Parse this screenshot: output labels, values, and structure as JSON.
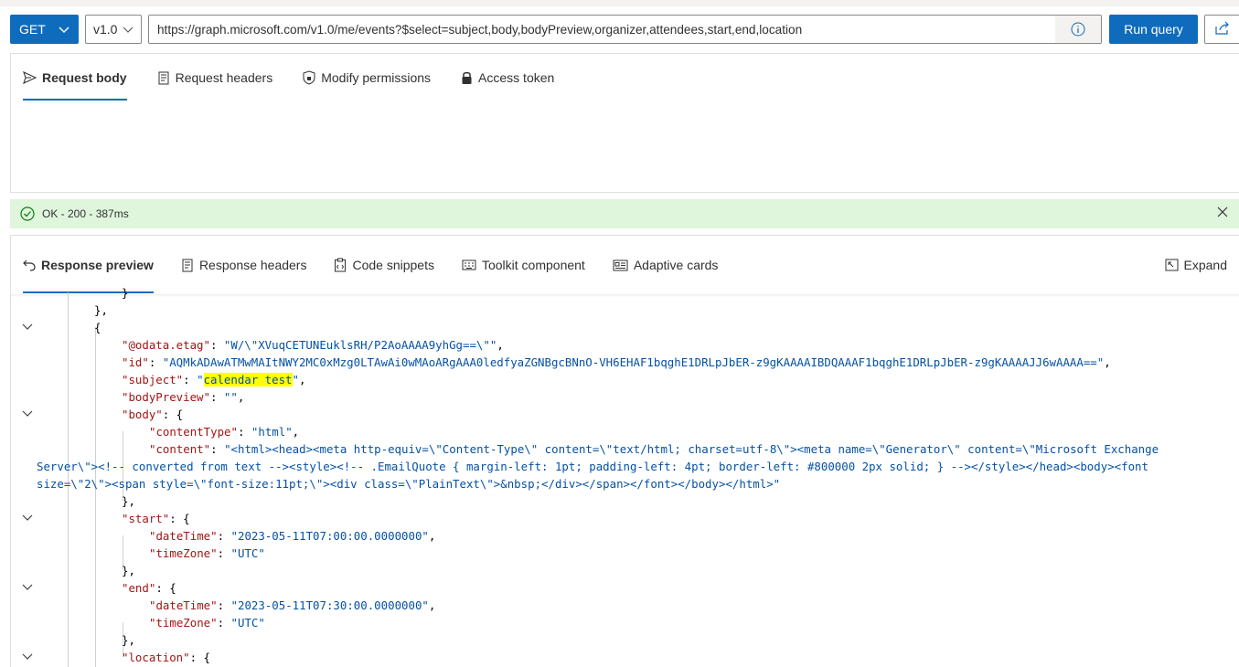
{
  "query": {
    "method": "GET",
    "version": "v1.0",
    "url": "https://graph.microsoft.com/v1.0/me/events?$select=subject,body,bodyPreview,organizer,attendees,start,end,location",
    "run_label": "Run query"
  },
  "request_tabs": [
    {
      "label": "Request body",
      "icon": "send-icon",
      "active": true
    },
    {
      "label": "Request headers",
      "icon": "document-icon"
    },
    {
      "label": "Modify permissions",
      "icon": "shield-lock-icon"
    },
    {
      "label": "Access token",
      "icon": "lock-icon"
    }
  ],
  "status": {
    "text": "OK - 200 - 387ms",
    "color": "#dff6dd"
  },
  "response_tabs": [
    {
      "label": "Response preview",
      "icon": "undo-arrow-icon",
      "active": true
    },
    {
      "label": "Response headers",
      "icon": "document-icon"
    },
    {
      "label": "Code snippets",
      "icon": "clipboard-code-icon"
    },
    {
      "label": "Toolkit component",
      "icon": "keyboard-icon"
    },
    {
      "label": "Adaptive cards",
      "icon": "card-icon"
    }
  ],
  "expand_label": "Expand",
  "response": {
    "closing_brace": "}",
    "closing_brace_comma": "},",
    "opening_brace": "{",
    "etag_key": "\"@odata.etag\"",
    "etag_value": "\"W/\\\"XVuqCETUNEuklsRH/P2AoAAAA9yhGg==\\\"\"",
    "id_key": "\"id\"",
    "id_value": "\"AQMkADAwATMwMAItNWY2MC0xMzg0LTAwAi0wMAoARgAAA0ledfyaZGNBgcBNnO-VH6EHAF1bqghE1DRLpJbER-z9gKAAAAIBDQAAAF1bqghE1DRLpJbER-z9gKAAAAJJ6wAAAA==\"",
    "subject_key": "\"subject\"",
    "subject_value": "calendar test",
    "bodyPreview_key": "\"bodyPreview\"",
    "bodyPreview_value": "\"\"",
    "body_key": "\"body\"",
    "contentType_key": "\"contentType\"",
    "contentType_value": "\"html\"",
    "content_key": "\"content\"",
    "content_line1": "\"<html><head><meta http-equiv=\\\"Content-Type\\\" content=\\\"text/html; charset=utf-8\\\"><meta name=\\\"Generator\\\" content=\\\"Microsoft Exchange",
    "content_line2": "Server\\\"><!-- converted from text --><style><!-- .EmailQuote { margin-left: 1pt; padding-left: 4pt; border-left: #800000 2px solid; } --></style></head><body><font",
    "content_line3": "size=\\\"2\\\"><span style=\\\"font-size:11pt;\\\"><div class=\\\"PlainText\\\">&nbsp;</div></span></font></body></html>\"",
    "start_key": "\"start\"",
    "end_key": "\"end\"",
    "dateTime_key": "\"dateTime\"",
    "start_dateTime": "\"2023-05-11T07:00:00.0000000\"",
    "end_dateTime": "\"2023-05-11T07:30:00.0000000\"",
    "timeZone_key": "\"timeZone\"",
    "timeZone_value": "\"UTC\"",
    "location_key": "\"location\""
  }
}
